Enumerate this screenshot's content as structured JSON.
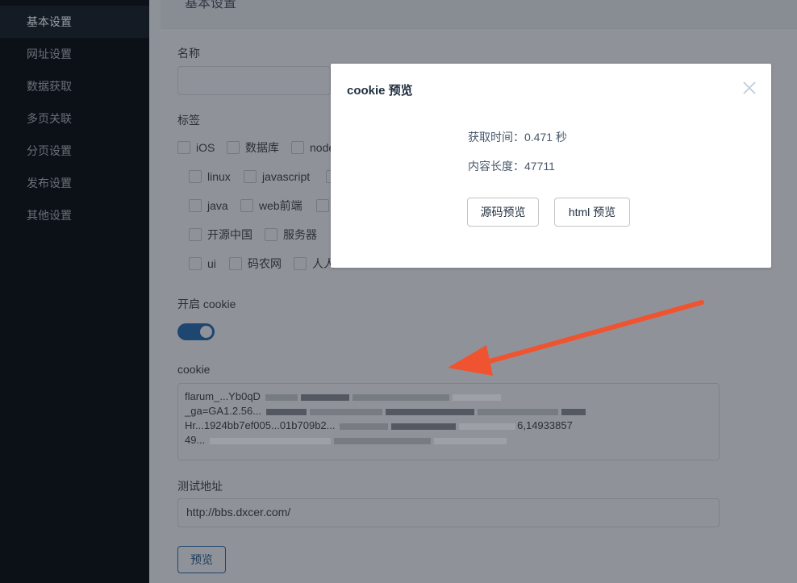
{
  "sidebar": {
    "items": [
      {
        "label": "基本设置",
        "active": true
      },
      {
        "label": "网址设置"
      },
      {
        "label": "数据获取"
      },
      {
        "label": "多页关联"
      },
      {
        "label": "分页设置"
      },
      {
        "label": "发布设置"
      },
      {
        "label": "其他设置"
      }
    ]
  },
  "form": {
    "card_title": "基本设置",
    "name_label": "名称",
    "tags_label": "标签",
    "tags_row1": [
      "iOS",
      "数据库",
      "node"
    ],
    "tags_row2": [
      "linux",
      "javascript"
    ],
    "tags_row3": [
      "java",
      "web前端"
    ],
    "tags_row4": [
      "开源中国",
      "服务器"
    ],
    "tags_row5": [
      "ui",
      "码农网",
      "人人"
    ],
    "cookie_toggle_label": "开启 cookie",
    "cookie_label": "cookie",
    "cookie_lines": [
      "flarum_...Yb0qD",
      "_ga=GA1.2.56...",
      "Hr...1924bb7ef005...01b709b2...",
      "49..."
    ],
    "cookie_line3_tail": "6,14933857",
    "test_url_label": "测试地址",
    "test_url_value": "http://bbs.dxcer.com/",
    "preview_button": "预览"
  },
  "modal": {
    "title": "cookie 预览",
    "fetch_time": "获取时间：0.471 秒",
    "content_length": "内容长度：47711",
    "source_preview_button": "源码预览",
    "html_preview_button": "html 预览"
  },
  "colors": {
    "accent": "#1d4670",
    "arrow": "#f0532f",
    "modal_bg": "#ffffff"
  }
}
